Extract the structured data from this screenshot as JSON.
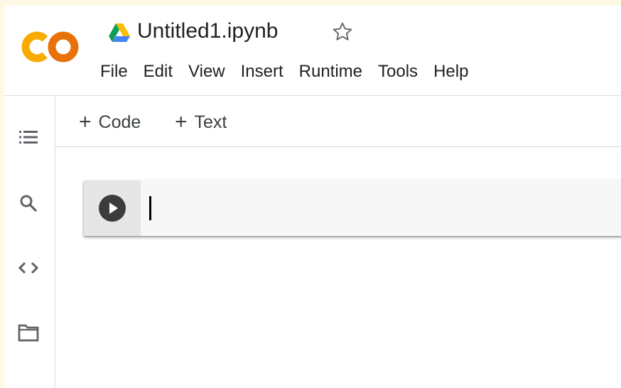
{
  "app": {
    "logo_text": "CO",
    "logo_colors": {
      "left": "#f9ab00",
      "right": "#e8710a"
    }
  },
  "document": {
    "title": "Untitled1.ipynb",
    "star_icon": "star-outline-icon",
    "drive_icon": "google-drive-icon"
  },
  "menu": {
    "items": [
      {
        "label": "File"
      },
      {
        "label": "Edit"
      },
      {
        "label": "View"
      },
      {
        "label": "Insert"
      },
      {
        "label": "Runtime"
      },
      {
        "label": "Tools"
      },
      {
        "label": "Help"
      }
    ]
  },
  "sidebar": {
    "icons": [
      "table-of-contents-icon",
      "search-icon",
      "code-snippets-icon",
      "folder-icon"
    ]
  },
  "toolbar": {
    "add_code_label": "Code",
    "add_text_label": "Text",
    "plus_glyph": "+"
  },
  "cell": {
    "type": "code",
    "content": "",
    "run_icon": "play-circle-icon"
  },
  "colors": {
    "page_background": "#fdf9e4",
    "cell_background": "#f7f7f7",
    "cell_gutter": "#e6e6e6",
    "run_button": "#3c3c3c",
    "divider": "#dadce0",
    "icon": "#5f6368"
  }
}
